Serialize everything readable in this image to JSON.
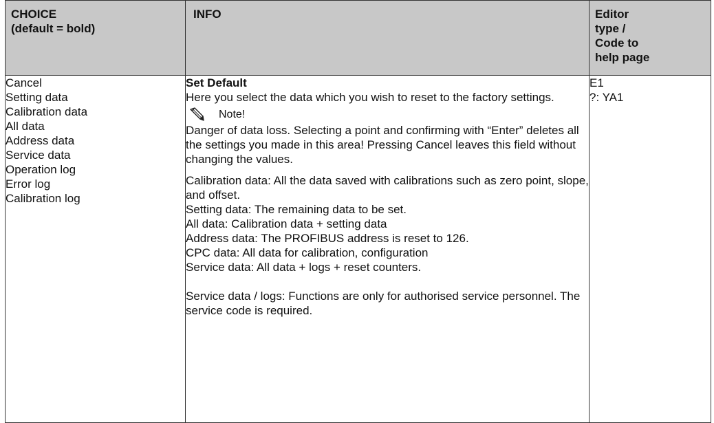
{
  "header": {
    "choice": "CHOICE\n(default = bold)",
    "choice_line1": "CHOICE",
    "choice_line2": "(default = bold)",
    "info": "INFO",
    "editor_lines": [
      "Editor",
      "type /",
      "Code to",
      "help page"
    ]
  },
  "choices": [
    "Cancel",
    "Setting data",
    "Calibration data",
    "All data",
    "Address data",
    "Service data",
    "Operation log",
    "Error log",
    "Calibration log"
  ],
  "info": {
    "title": "Set Default",
    "intro": "Here you select the data which you wish to reset to the factory settings.",
    "note_label": "Note!",
    "note_icon": "pencil-note-icon",
    "warning": "Danger of data loss. Selecting a point and confirming with “Enter” deletes all the settings you made in this area! Pressing Cancel leaves this field without changing the values.",
    "definitions": [
      "Calibration data: All the data saved with calibrations such as zero point, slope, and offset.",
      "Setting data: The remaining data to be set.",
      "All data: Calibration data + setting data",
      "Address data: The PROFIBUS address is reset to 126.",
      "CPC data: All data for calibration, configuration",
      "Service data: All data + logs + reset counters."
    ],
    "final_note": "Service data / logs: Functions are only for authorised service personnel. The service code is required."
  },
  "editor": [
    "E1",
    "?: YA1"
  ],
  "colors": {
    "header_bg": "#c8c8c8",
    "border": "#333333",
    "text": "#111111"
  }
}
